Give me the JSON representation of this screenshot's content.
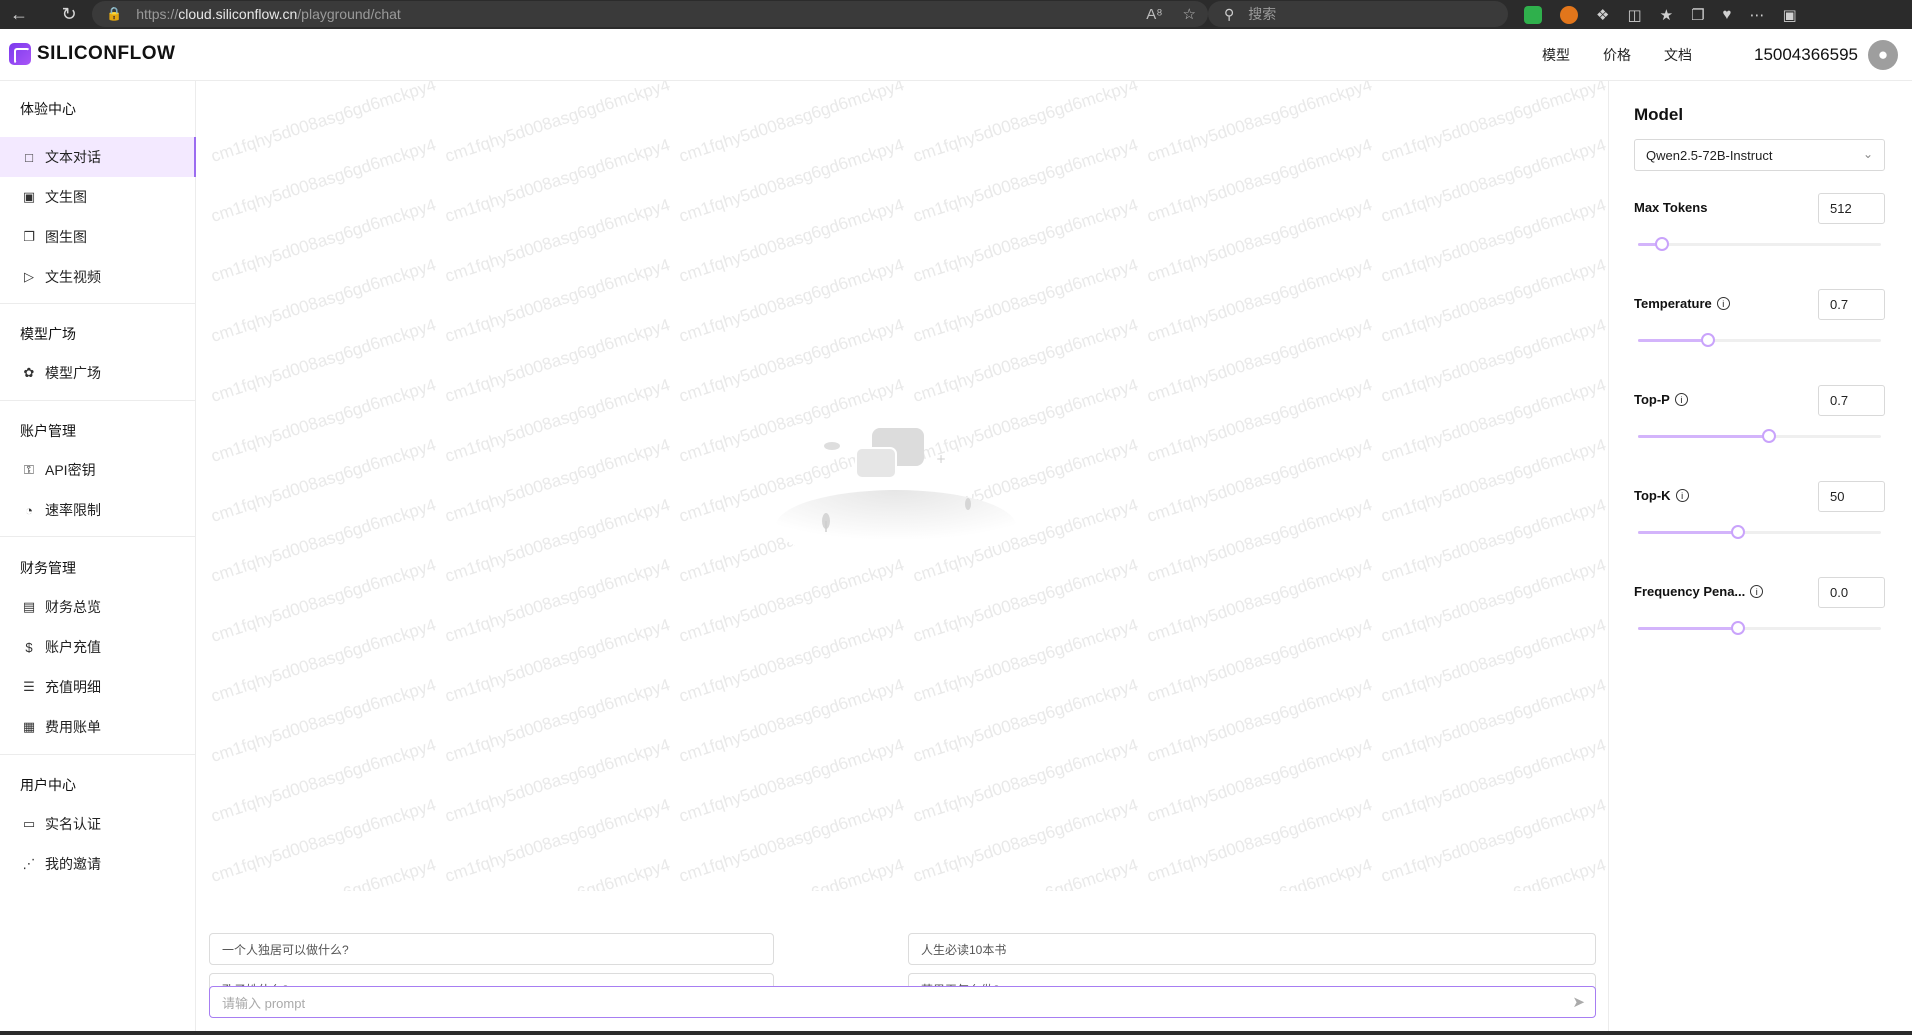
{
  "browser": {
    "url_prefix": "https://",
    "url_host": "cloud.siliconflow.cn",
    "url_path": "/playground/chat",
    "search_placeholder": "搜索"
  },
  "header": {
    "logo_text": "SILICONFLOW",
    "nav": [
      "模型",
      "价格",
      "文档"
    ],
    "phone": "15004366595"
  },
  "sidebar": {
    "sections": [
      {
        "title": "体验中心",
        "items": [
          {
            "label": "文本对话",
            "icon": "chat-bubble-icon",
            "active": true
          },
          {
            "label": "文生图",
            "icon": "image-icon"
          },
          {
            "label": "图生图",
            "icon": "images-icon"
          },
          {
            "label": "文生视频",
            "icon": "video-icon"
          }
        ]
      },
      {
        "title": "模型广场",
        "items": [
          {
            "label": "模型广场",
            "icon": "cluster-icon"
          }
        ]
      },
      {
        "title": "账户管理",
        "items": [
          {
            "label": "API密钥",
            "icon": "key-icon"
          },
          {
            "label": "速率限制",
            "icon": "gauge-icon"
          }
        ]
      },
      {
        "title": "财务管理",
        "items": [
          {
            "label": "财务总览",
            "icon": "document-icon"
          },
          {
            "label": "账户充值",
            "icon": "dollar-icon"
          },
          {
            "label": "充值明细",
            "icon": "list-icon"
          },
          {
            "label": "费用账单",
            "icon": "bill-icon"
          }
        ]
      },
      {
        "title": "用户中心",
        "items": [
          {
            "label": "实名认证",
            "icon": "id-card-icon"
          },
          {
            "label": "我的邀请",
            "icon": "share-icon"
          }
        ]
      }
    ]
  },
  "main": {
    "watermark": "cm1fqhy5d008asg6gd6mckpy4",
    "suggestions": [
      "一个人独居可以做什么?",
      "人生必读10本书",
      "孔子姓什么?",
      "苹果干怎么做?"
    ],
    "prompt_placeholder": "请输入 prompt"
  },
  "panel": {
    "title": "Model",
    "model": "Qwen2.5-72B-Instruct",
    "params": [
      {
        "label": "Max Tokens",
        "value": "512",
        "fraction": 0.1,
        "info": false
      },
      {
        "label": "Temperature",
        "value": "0.7",
        "fraction": 0.29,
        "info": true
      },
      {
        "label": "Top-P",
        "value": "0.7",
        "fraction": 0.54,
        "info": true
      },
      {
        "label": "Top-K",
        "value": "50",
        "fraction": 0.41,
        "info": true
      },
      {
        "label": "Frequency Pena...",
        "value": "0.0",
        "fraction": 0.41,
        "info": true
      }
    ]
  },
  "colors": {
    "accent": "#9b6cf0",
    "active_bg": "#f3e9ff",
    "slider_fill": "#d3b4fb"
  }
}
